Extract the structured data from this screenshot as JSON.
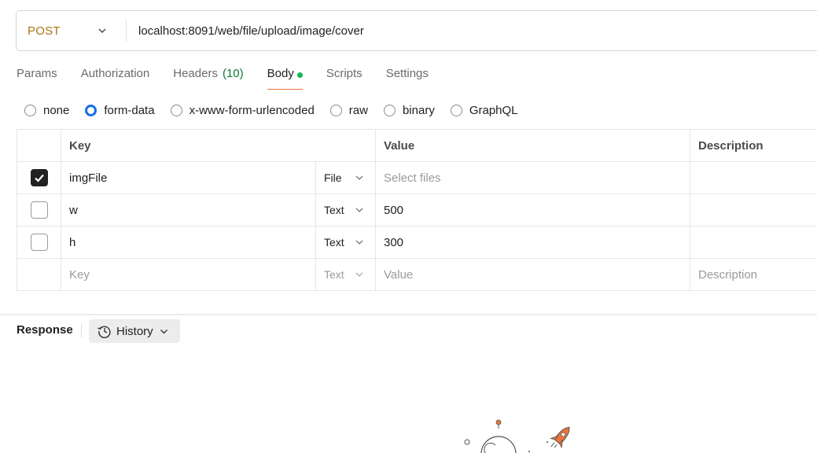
{
  "request": {
    "method": "POST",
    "url": "localhost:8091/web/file/upload/image/cover"
  },
  "tabs": [
    {
      "label": "Params"
    },
    {
      "label": "Authorization"
    },
    {
      "label": "Headers",
      "count": "(10)"
    },
    {
      "label": "Body",
      "active": true
    },
    {
      "label": "Scripts"
    },
    {
      "label": "Settings"
    }
  ],
  "body_types": [
    {
      "label": "none",
      "selected": false
    },
    {
      "label": "form-data",
      "selected": true
    },
    {
      "label": "x-www-form-urlencoded",
      "selected": false
    },
    {
      "label": "raw",
      "selected": false
    },
    {
      "label": "binary",
      "selected": false
    },
    {
      "label": "GraphQL",
      "selected": false
    }
  ],
  "table": {
    "headers": {
      "key": "Key",
      "value": "Value",
      "description": "Description"
    },
    "rows": [
      {
        "checked": true,
        "key": "imgFile",
        "type": "File",
        "value": "",
        "value_placeholder": "Select files"
      },
      {
        "checked": false,
        "key": "w",
        "type": "Text",
        "value": "500"
      },
      {
        "checked": false,
        "key": "h",
        "type": "Text",
        "value": "300"
      }
    ],
    "new_row": {
      "key_placeholder": "Key",
      "type": "Text",
      "value_placeholder": "Value",
      "description_placeholder": "Description"
    }
  },
  "response": {
    "label": "Response",
    "history_label": "History"
  },
  "colors": {
    "method": "#a8760b",
    "active_tab_underline": "#e8763a",
    "body_dot": "#0cbb52",
    "radio_selected": "#1a6ee6",
    "headers_count": "#0c7a32"
  }
}
